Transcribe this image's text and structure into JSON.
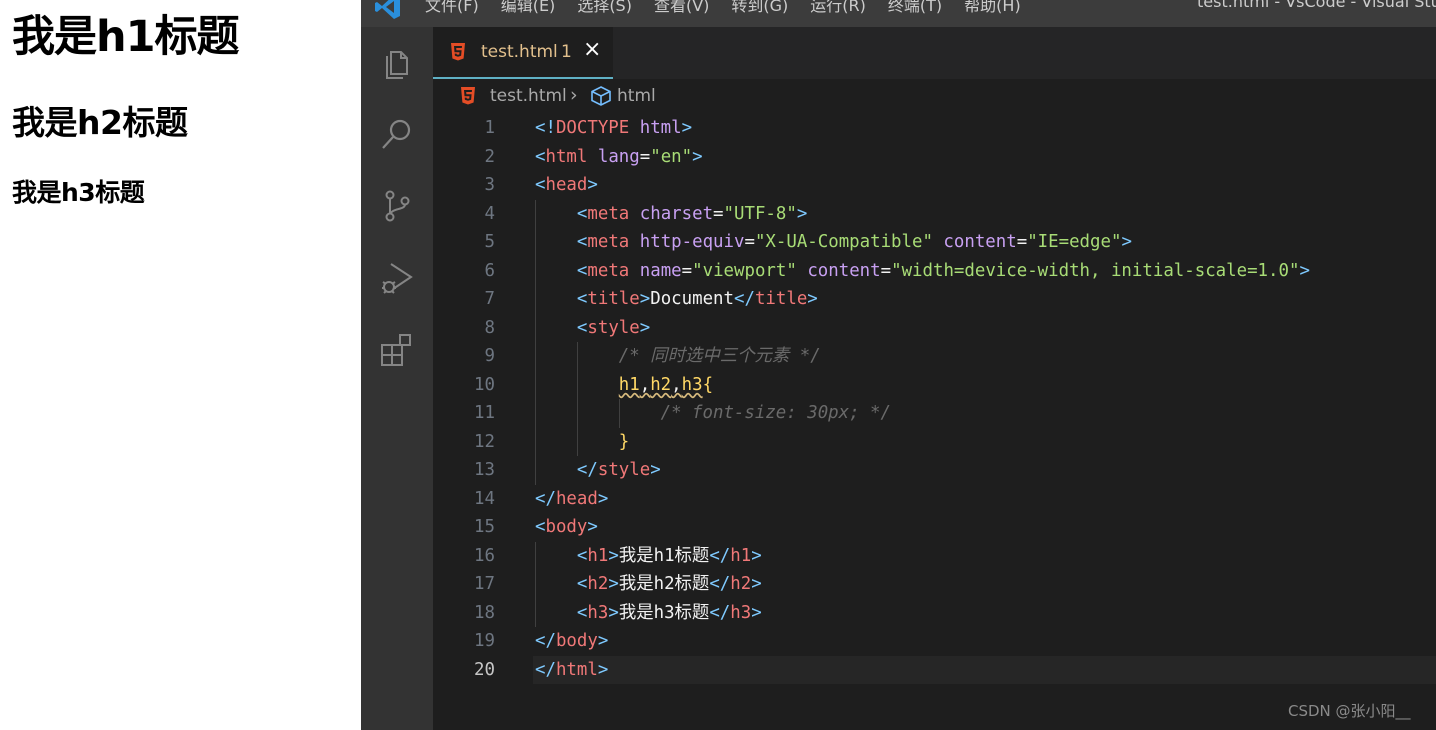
{
  "preview": {
    "h1": "我是h1标题",
    "h2": "我是h2标题",
    "h3": "我是h3标题"
  },
  "titlebar": {
    "menu": [
      "文件(F)",
      "编辑(E)",
      "选择(S)",
      "查看(V)",
      "转到(G)",
      "运行(R)",
      "终端(T)",
      "帮助(H)"
    ],
    "window_title": "test.html - VsCode - Visual Stu"
  },
  "activity_icons": [
    "explorer-icon",
    "search-icon",
    "source-control-icon",
    "run-debug-icon",
    "extensions-icon"
  ],
  "tab": {
    "name": "test.html",
    "problems": "1",
    "close": "×"
  },
  "breadcrumb": {
    "file": "test.html",
    "separator": "›",
    "element": "html"
  },
  "code": {
    "line_numbers": [
      "1",
      "2",
      "3",
      "4",
      "5",
      "6",
      "7",
      "8",
      "9",
      "10",
      "11",
      "12",
      "13",
      "14",
      "15",
      "16",
      "17",
      "18",
      "19",
      "20"
    ],
    "current_line": "20",
    "lines": [
      "<!DOCTYPE html>",
      "<html lang=\"en\">",
      "<head>",
      "    <meta charset=\"UTF-8\">",
      "    <meta http-equiv=\"X-UA-Compatible\" content=\"IE=edge\">",
      "    <meta name=\"viewport\" content=\"width=device-width, initial-scale=1.0\">",
      "    <title>Document</title>",
      "    <style>",
      "        /* 同时选中三个元素 */",
      "        h1,h2,h3{",
      "            /* font-size: 30px; */",
      "        }",
      "    </style>",
      "</head>",
      "<body>",
      "    <h1>我是h1标题</h1>",
      "    <h2>我是h2标题</h2>",
      "    <h3>我是h3标题</h3>",
      "</body>",
      "</html>"
    ]
  },
  "watermark": "CSDN @张小阳__",
  "colors": {
    "editor_bg": "#1e1e1e",
    "activitybar_bg": "#333333",
    "tab_label": "#e2c08d",
    "tag": "#f07878",
    "attribute": "#c8a0f2",
    "string": "#a8dc76",
    "punctuation": "#7fcaff"
  }
}
